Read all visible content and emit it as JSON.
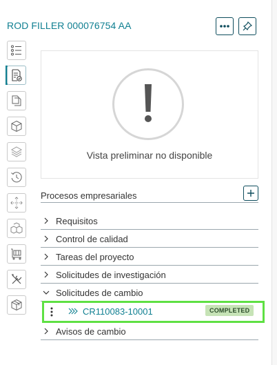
{
  "header": {
    "title": "ROD FILLER 000076754 AA"
  },
  "rail": {
    "items": [
      {
        "icon": "list-icon",
        "active": false
      },
      {
        "icon": "document-check-icon",
        "active": true
      },
      {
        "icon": "copy-icon",
        "active": false
      },
      {
        "icon": "cube-icon",
        "active": false
      },
      {
        "icon": "layers-icon",
        "active": false
      },
      {
        "icon": "history-icon",
        "active": false
      },
      {
        "icon": "move-arrows-icon",
        "active": false
      },
      {
        "icon": "boxes-icon",
        "active": false
      },
      {
        "icon": "cart-icon",
        "active": false
      },
      {
        "icon": "tools-icon",
        "active": false
      },
      {
        "icon": "package-icon",
        "active": false
      }
    ]
  },
  "preview": {
    "message": "Vista preliminar no disponible"
  },
  "processes": {
    "label": "Procesos empresariales",
    "sections": [
      {
        "label": "Requisitos",
        "expanded": false
      },
      {
        "label": "Control de calidad",
        "expanded": false
      },
      {
        "label": "Tareas del proyecto",
        "expanded": false
      },
      {
        "label": "Solicitudes de investigación",
        "expanded": false
      },
      {
        "label": "Solicitudes de cambio",
        "expanded": true
      },
      {
        "label": "Avisos de cambio",
        "expanded": false
      }
    ],
    "change_request": {
      "id": "CR110083-10001",
      "status": "COMPLETED"
    }
  },
  "colors": {
    "accent": "#0f7f91",
    "highlight": "#5ee043",
    "badge": "#c6e3b6"
  }
}
